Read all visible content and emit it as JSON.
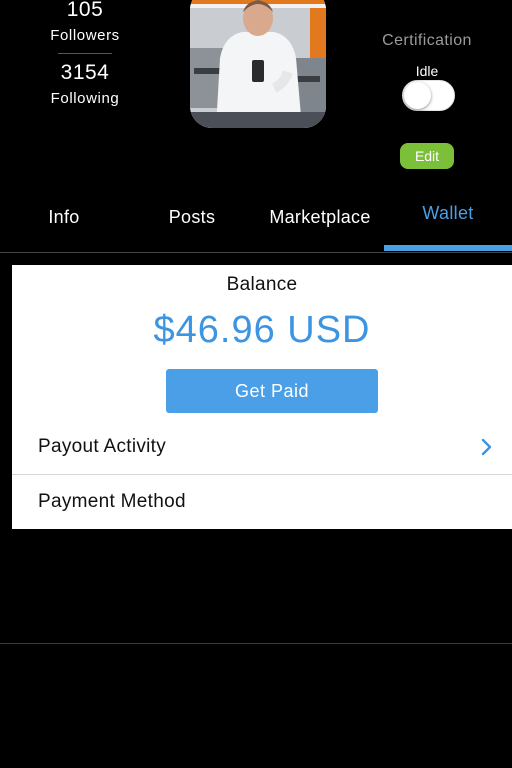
{
  "profile": {
    "followers_count": "105",
    "followers_label": "Followers",
    "following_count": "3154",
    "following_label": "Following",
    "certification_title": "Certification",
    "certification_status": "Idle",
    "certification_toggle_on": false,
    "edit_label": "Edit"
  },
  "tabs": [
    {
      "label": "Info",
      "active": false
    },
    {
      "label": "Posts",
      "active": false
    },
    {
      "label": "Marketplace",
      "active": false
    },
    {
      "label": "Wallet",
      "active": true
    }
  ],
  "wallet": {
    "balance_label": "Balance",
    "balance_amount": "$46.96 USD",
    "get_paid_label": "Get Paid",
    "rows": [
      {
        "label": "Payout Activity",
        "icon": "chevron-right-icon"
      },
      {
        "label": "Payment Method"
      }
    ]
  },
  "colors": {
    "accent_blue": "#4a9fe6",
    "edit_green": "#7cc03a",
    "background": "#000000"
  }
}
